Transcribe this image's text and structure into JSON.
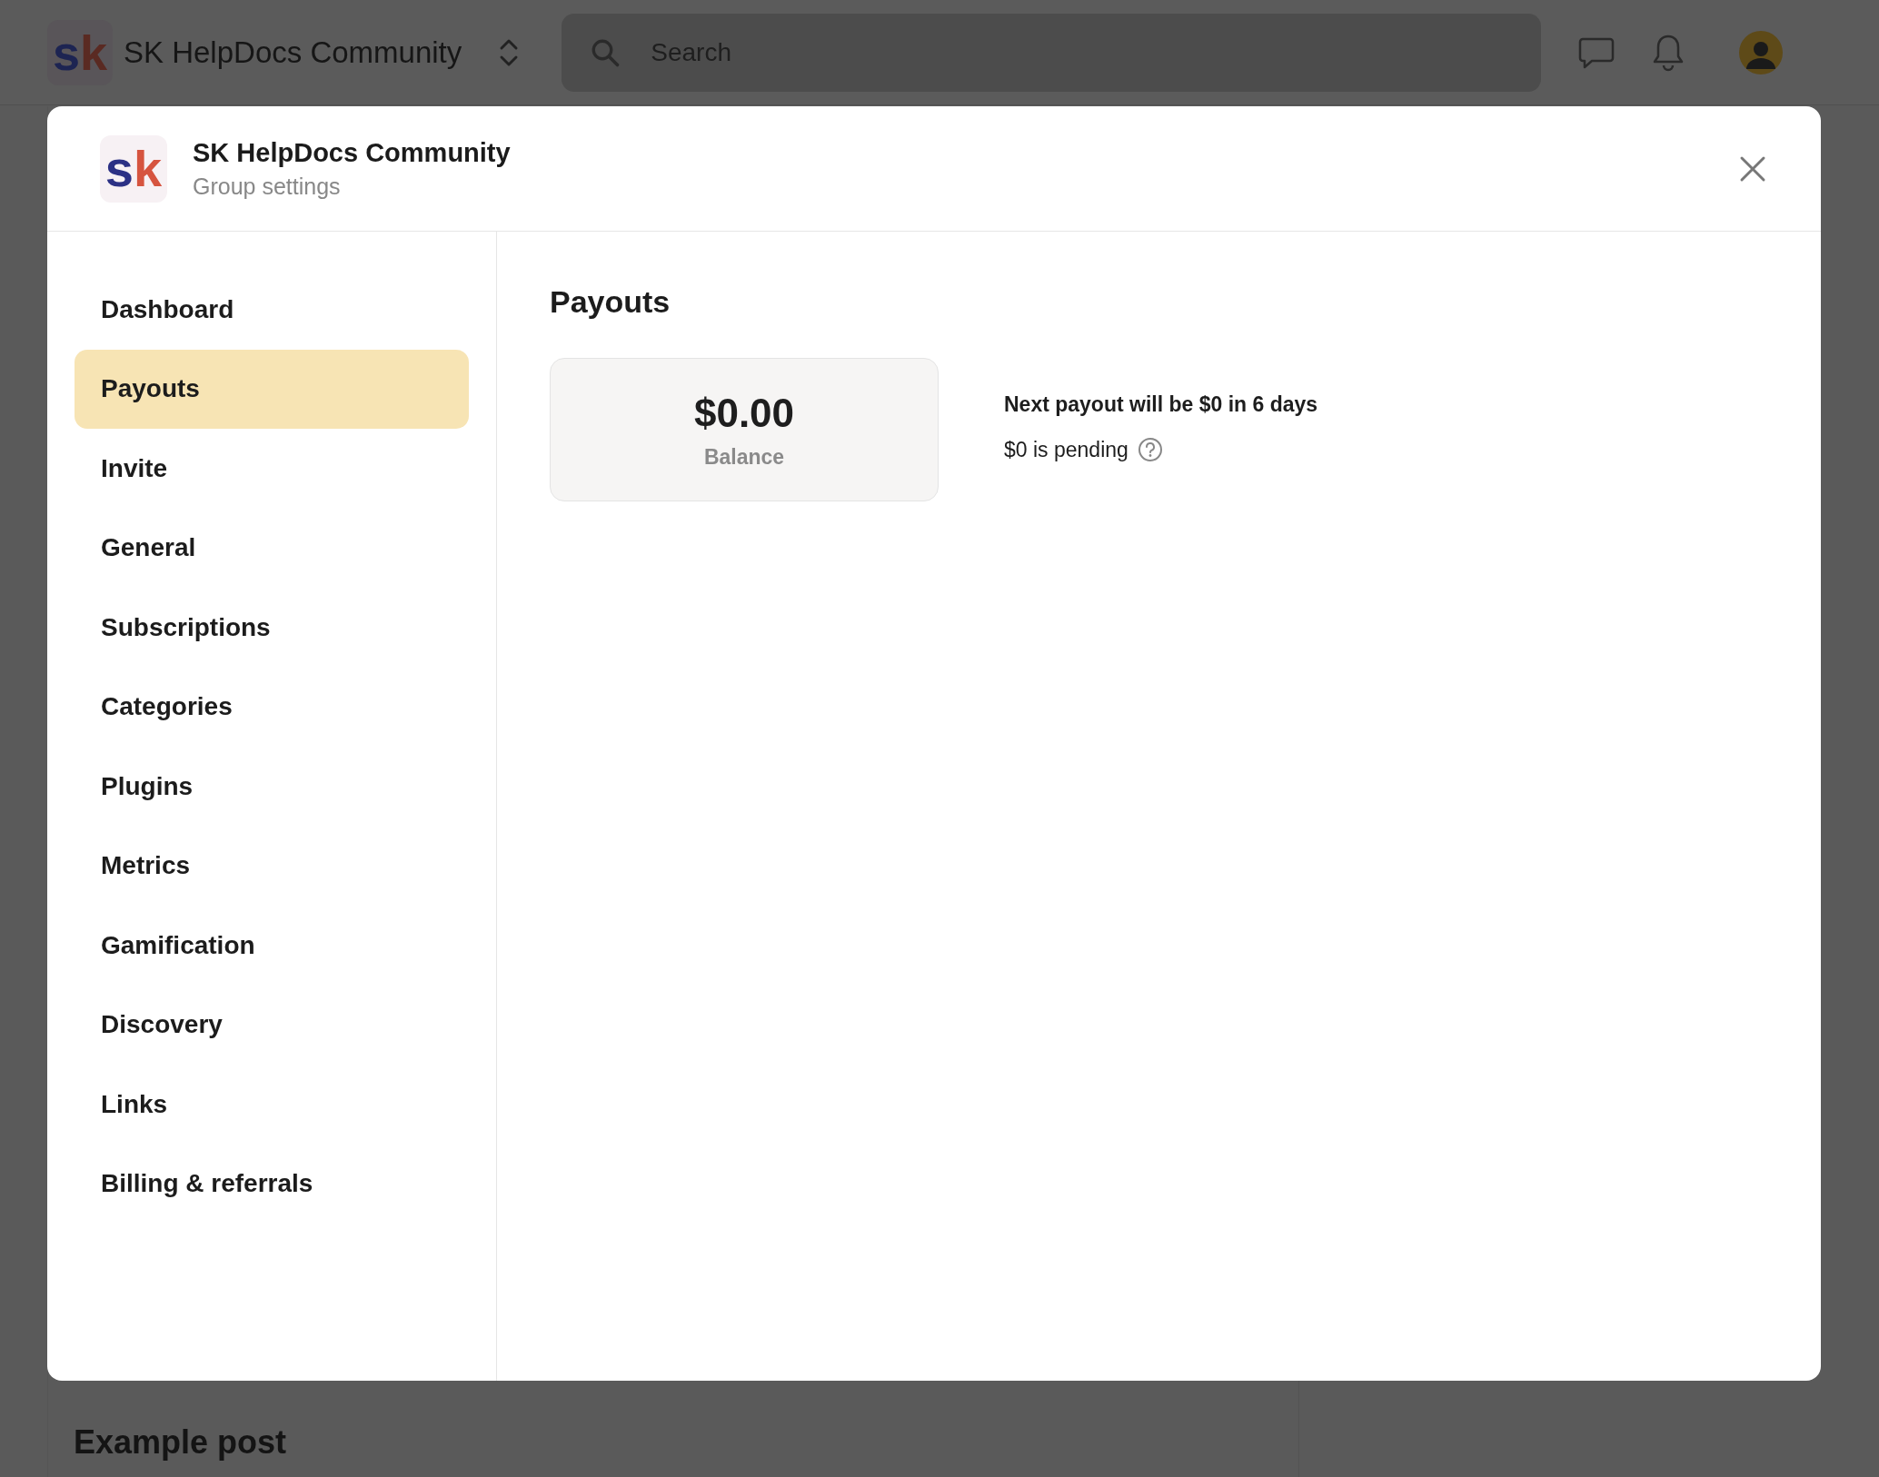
{
  "topbar": {
    "community": "SK HelpDocs Community",
    "logo": "sk",
    "search": {
      "placeholder": "Search"
    }
  },
  "background_post": {
    "title": "Example post"
  },
  "modal": {
    "logo": "sk",
    "title": "SK HelpDocs Community",
    "subtitle": "Group settings",
    "nav": [
      {
        "label": "Dashboard",
        "selected": false
      },
      {
        "label": "Payouts",
        "selected": true
      },
      {
        "label": "Invite",
        "selected": false
      },
      {
        "label": "General",
        "selected": false
      },
      {
        "label": "Subscriptions",
        "selected": false
      },
      {
        "label": "Categories",
        "selected": false
      },
      {
        "label": "Plugins",
        "selected": false
      },
      {
        "label": "Metrics",
        "selected": false
      },
      {
        "label": "Gamification",
        "selected": false
      },
      {
        "label": "Discovery",
        "selected": false
      },
      {
        "label": "Links",
        "selected": false
      },
      {
        "label": "Billing & referrals",
        "selected": false
      }
    ],
    "heading": "Payouts",
    "balance": {
      "amount": "$0.00",
      "label": "Balance"
    },
    "next_payout": "Next payout will be $0 in 6 days",
    "pending": "$0 is pending"
  }
}
